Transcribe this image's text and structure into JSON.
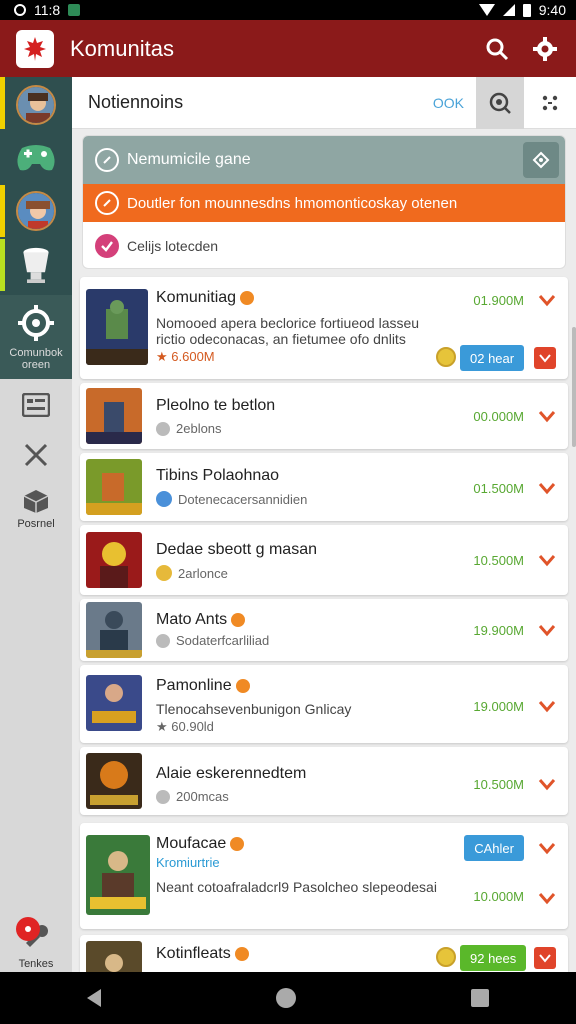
{
  "status_bar": {
    "time_left": "11:8",
    "time_right": "9:40"
  },
  "app_bar": {
    "title": "Komunitas",
    "search_icon": "search-icon",
    "settings_icon": "gear-icon"
  },
  "sidebar": {
    "items": [
      {
        "name": "avatar-1",
        "accent": "#f0d000"
      },
      {
        "name": "game-controller",
        "accent": ""
      },
      {
        "name": "avatar-2",
        "accent": "#f0d000"
      },
      {
        "name": "cup",
        "accent": "#b8e020"
      },
      {
        "name": "settings",
        "label": "Comunbok oreen"
      },
      {
        "name": "card",
        "label": ""
      },
      {
        "name": "close",
        "label": ""
      },
      {
        "name": "boxes",
        "label": "Posrnel"
      },
      {
        "name": "notifications",
        "label": "Tenkes",
        "badge": ""
      }
    ]
  },
  "header": {
    "title": "Notiennoins",
    "ok_label": "OOK"
  },
  "notice": {
    "gray_text": "Nemumicile gane",
    "orange_text": "Doutler fon mounnesdns hmomonticoskay otenen",
    "white_text": "Celijs lotecden"
  },
  "items": [
    {
      "title": "Komunitiag",
      "desc": "Nomooed apera beclorice fortiueod lasseu rictio odeconacas, an fietumee ofo dnlits",
      "sub": "★ 6.600M",
      "size": "01.900M",
      "pill": "02 hear"
    },
    {
      "title": "Pleolno te betlon",
      "sub": "2eblons",
      "size": "00.000M"
    },
    {
      "title": "Tibins Polaohnao",
      "sub": "Dotenecacersannidien",
      "size": "01.500M"
    },
    {
      "title": "Dedae sbeott g masan",
      "sub": "2arlonce",
      "size": "10.500M"
    },
    {
      "title": "Mato Ants",
      "sub": "Sodaterfcarliliad",
      "size": "19.900M"
    },
    {
      "title": "Pamonline",
      "desc": "Tlenocahsevenbunigon Gnlicay",
      "sub": "★ 60.90ld",
      "size": "19.000M"
    },
    {
      "title": "Alaie eskerennedtem",
      "sub": "200mcas",
      "size": "10.500M"
    },
    {
      "title": "Moufacae",
      "link": "Kromiurtrie",
      "desc": "Neant cotoafraladcrl9 Pasolcheo slepeodesai",
      "pill": "CAhler",
      "size": "10.000M"
    },
    {
      "title": "Kotinfleats",
      "sub": "",
      "pill": "92 hees"
    }
  ]
}
